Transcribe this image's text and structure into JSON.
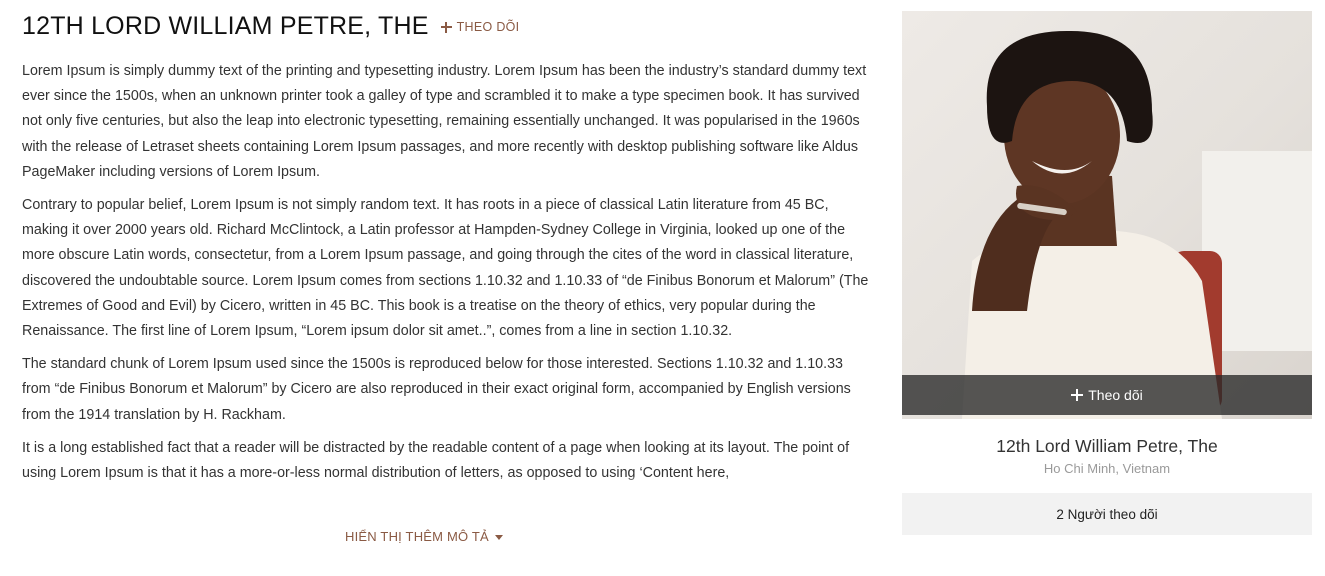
{
  "profile": {
    "title": "12TH LORD WILLIAM PETRE, THE",
    "follow_label": "THEO DÕI",
    "description": [
      "Lorem Ipsum is simply dummy text of the printing and typesetting industry. Lorem Ipsum has been the industry’s standard dummy text ever since the 1500s, when an unknown printer took a galley of type and scrambled it to make a type specimen book. It has survived not only five centuries, but also the leap into electronic typesetting, remaining essentially unchanged. It was popularised in the 1960s with the release of Letraset sheets containing Lorem Ipsum passages, and more recently with desktop publishing software like Aldus PageMaker including versions of Lorem Ipsum.",
      "Contrary to popular belief, Lorem Ipsum is not simply random text. It has roots in a piece of classical Latin literature from 45 BC, making it over 2000 years old. Richard McClintock, a Latin professor at Hampden-Sydney College in Virginia, looked up one of the more obscure Latin words, consectetur, from a Lorem Ipsum passage, and going through the cites of the word in classical literature, discovered the undoubtable source. Lorem Ipsum comes from sections 1.10.32 and 1.10.33 of “de Finibus Bonorum et Malorum” (The Extremes of Good and Evil) by Cicero, written in 45 BC. This book is a treatise on the theory of ethics, very popular during the Renaissance. The first line of Lorem Ipsum, “Lorem ipsum dolor sit amet..”, comes from a line in section 1.10.32.",
      "The standard chunk of Lorem Ipsum used since the 1500s is reproduced below for those interested. Sections 1.10.32 and 1.10.33 from “de Finibus Bonorum et Malorum” by Cicero are also reproduced in their exact original form, accompanied by English versions from the 1914 translation by H. Rackham.",
      "It is a long established fact that a reader will be distracted by the readable content of a page when looking at its layout. The point of using Lorem Ipsum is that it has a more-or-less normal distribution of letters, as opposed to using ‘Content here,"
    ],
    "show_more_label": "HIỂN THỊ THÊM MÔ TẢ"
  },
  "card": {
    "follow_overlay_label": "Theo dõi",
    "name": "12th Lord William Petre, The",
    "location": "Ho Chi Minh, Vietnam",
    "followers_label": "2 Người theo dõi"
  },
  "colors": {
    "accent": "#8a5a44",
    "overlay": "#282828",
    "followers_bg": "#f2f2f2",
    "muted_text": "#9a9a9a"
  },
  "icons": {
    "follow": "plus-icon",
    "show_more": "caret-down-icon"
  }
}
